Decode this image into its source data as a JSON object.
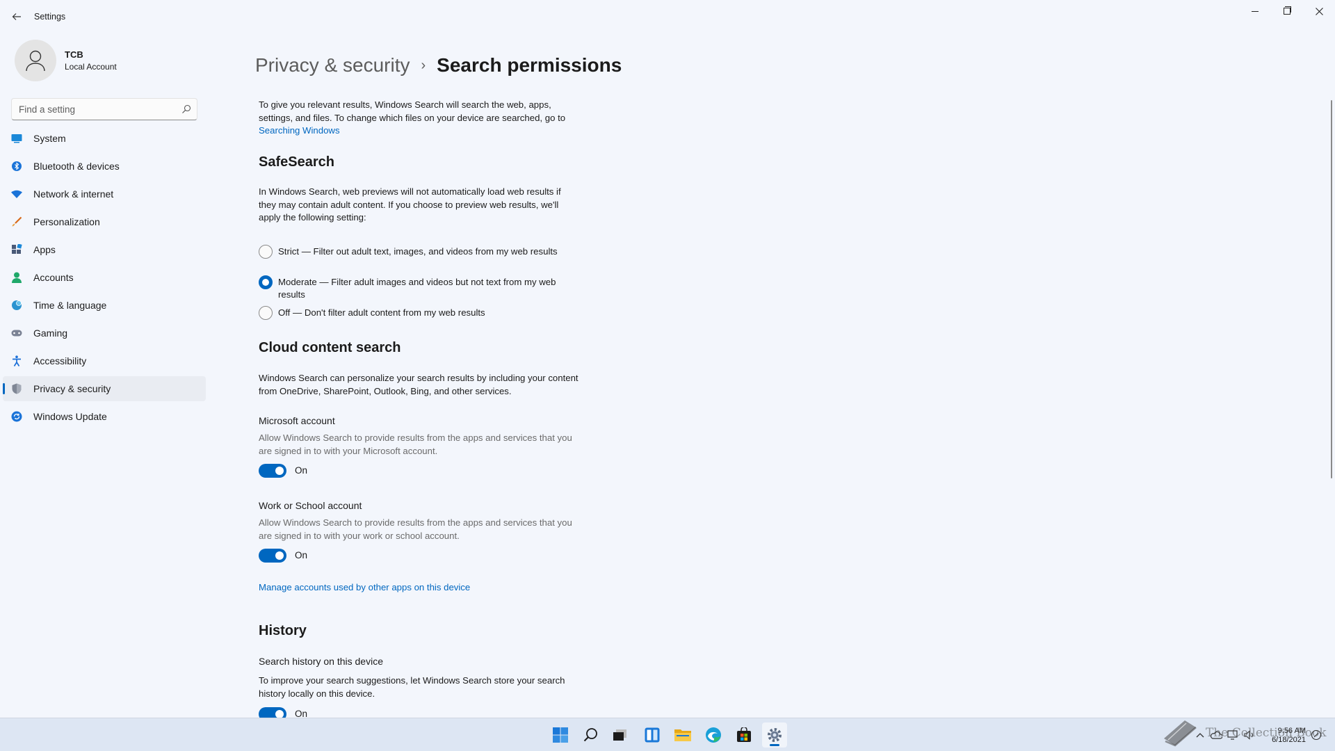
{
  "window": {
    "title": "Settings"
  },
  "profile": {
    "name": "TCB",
    "type": "Local Account"
  },
  "search": {
    "placeholder": "Find a setting"
  },
  "sidebar": {
    "items": [
      {
        "label": "System",
        "icon": "system-icon",
        "active": false
      },
      {
        "label": "Bluetooth & devices",
        "icon": "bluetooth-icon",
        "active": false
      },
      {
        "label": "Network & internet",
        "icon": "wifi-icon",
        "active": false
      },
      {
        "label": "Personalization",
        "icon": "brush-icon",
        "active": false
      },
      {
        "label": "Apps",
        "icon": "apps-icon",
        "active": false
      },
      {
        "label": "Accounts",
        "icon": "person-icon",
        "active": false
      },
      {
        "label": "Time & language",
        "icon": "globe-clock-icon",
        "active": false
      },
      {
        "label": "Gaming",
        "icon": "gamepad-icon",
        "active": false
      },
      {
        "label": "Accessibility",
        "icon": "accessibility-icon",
        "active": false
      },
      {
        "label": "Privacy & security",
        "icon": "shield-icon",
        "active": true
      },
      {
        "label": "Windows Update",
        "icon": "update-icon",
        "active": false
      }
    ]
  },
  "breadcrumb": {
    "parent": "Privacy & security",
    "separator": "›",
    "current": "Search permissions"
  },
  "intro": {
    "text": "To give you relevant results, Windows Search will search the web, apps, settings, and files. To change which files on your device are searched, go to",
    "link": "Searching Windows"
  },
  "safesearch": {
    "heading": "SafeSearch",
    "description": "In Windows Search, web previews will not automatically load web results if they may contain adult content. If you choose to preview web results, we'll apply the following setting:",
    "selected": "Moderate",
    "options": [
      {
        "label": "Strict — Filter out adult text, images, and videos from my web results",
        "checked": false
      },
      {
        "label": "Moderate — Filter adult images and videos but not text from my web results",
        "checked": true
      },
      {
        "label": "Off — Don't filter adult content from my web results",
        "checked": false
      }
    ]
  },
  "cloud": {
    "heading": "Cloud content search",
    "description": "Windows Search can personalize your search results by including your content from OneDrive, SharePoint, Outlook, Bing, and other services.",
    "microsoft": {
      "title": "Microsoft account",
      "description": "Allow Windows Search to provide results from the apps and services that you are signed in to with your Microsoft account.",
      "toggle": "On"
    },
    "work": {
      "title": "Work or School account",
      "description": "Allow Windows Search to provide results from the apps and services that you are signed in to with your work or school account.",
      "toggle": "On"
    },
    "manage_link": "Manage accounts used by other apps on this device"
  },
  "history": {
    "heading": "History",
    "title": "Search history on this device",
    "description": "To improve your search suggestions, let Windows Search store your search history locally on this device.",
    "toggle": "On"
  },
  "taskbar": {
    "apps": [
      "start-icon",
      "search-icon",
      "task-view-icon",
      "widgets-icon",
      "file-explorer-icon",
      "edge-icon",
      "store-icon",
      "settings-icon"
    ],
    "time": "9:56 AM",
    "date": "6/18/2021",
    "watermark": "The Collection Book"
  },
  "colors": {
    "accent": "#0067c0",
    "background": "#f3f6fc",
    "taskbar": "#dde6f3"
  }
}
